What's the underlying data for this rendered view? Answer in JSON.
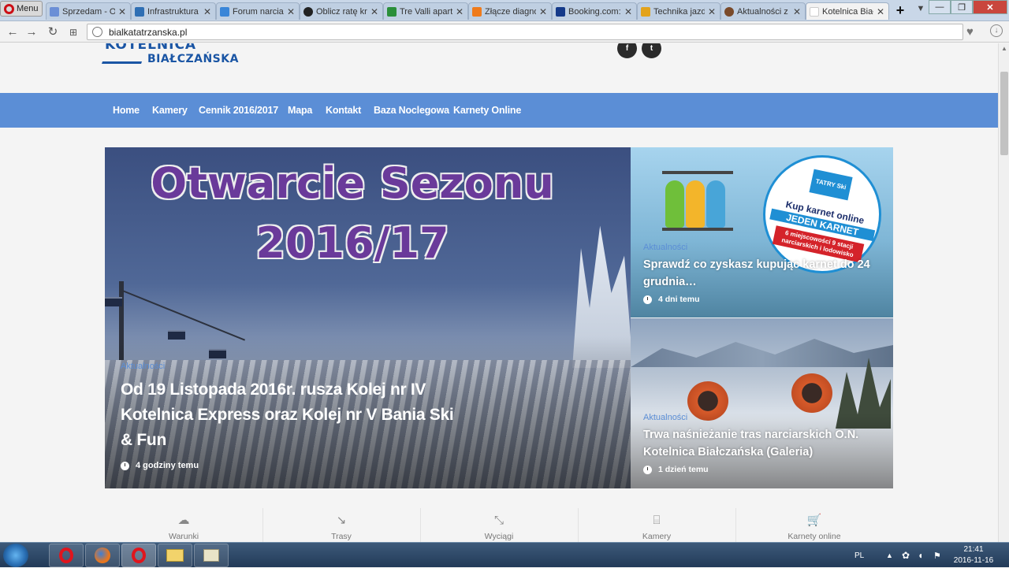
{
  "browser": {
    "menu_label": "Menu",
    "tabs": [
      {
        "title": "Sprzedam - O",
        "fav_color": "#6b8fd6"
      },
      {
        "title": "Infrastruktura",
        "fav_color": "#2f6fb4"
      },
      {
        "title": "Forum narciars",
        "fav_color": "#3a86d8"
      },
      {
        "title": "Oblicz ratę kred",
        "fav_color": "#222222"
      },
      {
        "title": "Tre Valli apartm",
        "fav_color": "#2a8f3a"
      },
      {
        "title": "Złącze diagnos",
        "fav_color": "#ef7b1c"
      },
      {
        "title": "Booking.com:",
        "fav_color": "#153a8a"
      },
      {
        "title": "Technika jazdy",
        "fav_color": "#e3a31c"
      },
      {
        "title": "Aktualności z K",
        "fav_color": "#7a4a2a"
      },
      {
        "title": "Kotelnica Białc",
        "fav_color": "#ffffff"
      }
    ],
    "url": "bialkatatrzanska.pl"
  },
  "site": {
    "logo_top": "KOTELNICA",
    "logo_bottom": "BIAŁCZAŃSKA",
    "social": [
      "f",
      "t"
    ],
    "menu": [
      "Home",
      "Kamery",
      "Cennik 2016/2017",
      "Mapa",
      "Kontakt",
      "Baza Noclegowa",
      "Karnety Online"
    ],
    "hero": {
      "image_text_line1": "Otwarcie Sezonu",
      "image_text_line2": "2016/17",
      "category": "Aktualności",
      "title": "Od 19 Listopada 2016r. rusza Kolej nr IV Kotelnica Express oraz Kolej nr V Bania Ski & Fun",
      "time": "4 godziny temu"
    },
    "side_posts": [
      {
        "category": "Aktualności",
        "title": "Sprawdź co zyskasz kupując karnet do 24 grudnia…",
        "time": "4 dni temu",
        "promo_logo": "TATRY Ski",
        "promo_kup": "Kup karnet online",
        "promo_jeden": "JEDEN KARNET",
        "promo_miej": "6 miejscowości 9 stacji narciarskich i lodowisko"
      },
      {
        "category": "Aktualności",
        "title": "Trwa naśnieżanie tras narciarskich O.N. Kotelnica Białczańska (Galeria)",
        "time": "1 dzień temu"
      }
    ],
    "quick_links": [
      {
        "label": "Warunki",
        "icon": "cloud-icon",
        "glyph": "☁"
      },
      {
        "label": "Trasy",
        "icon": "trend-down-icon",
        "glyph": "↘"
      },
      {
        "label": "Wyciągi",
        "icon": "diagonal-arrows-icon",
        "glyph": "⤡"
      },
      {
        "label": "Kamery",
        "icon": "camera-icon",
        "glyph": "⌸"
      },
      {
        "label": "Karnety online",
        "icon": "cart-icon",
        "glyph": "🛒"
      }
    ]
  },
  "taskbar": {
    "lang": "PL",
    "time": "21:41",
    "date": "2016-11-16"
  }
}
